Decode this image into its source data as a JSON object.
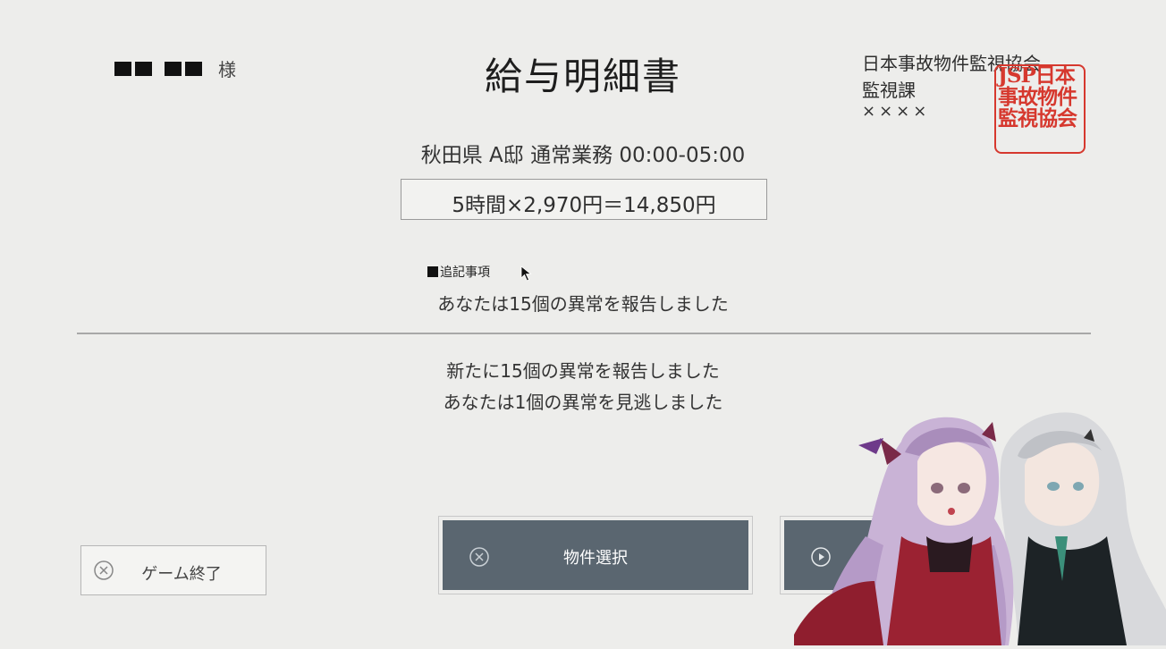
{
  "document": {
    "recipient_suffix": "様",
    "title": "給与明細書",
    "issuer_org": "日本事故物件監視協会",
    "issuer_dept": "監視課",
    "issuer_person": "××××",
    "seal_text": "JSP日本事故物件監視協会",
    "seal_color": "#d6382e"
  },
  "shift": {
    "description": "秋田県 A邸 通常業務 00:00-05:00",
    "calculation": "5時間×2,970円＝14,850円"
  },
  "notes": {
    "heading": "追記事項",
    "line1": "あなたは15個の異常を報告しました"
  },
  "results": {
    "line1": "新たに15個の異常を報告しました",
    "line2": "あなたは1個の異常を見逃しました"
  },
  "buttons": {
    "exit_label": "ゲーム終了",
    "property_select_label": "物件選択",
    "accent": "#5a6670"
  }
}
